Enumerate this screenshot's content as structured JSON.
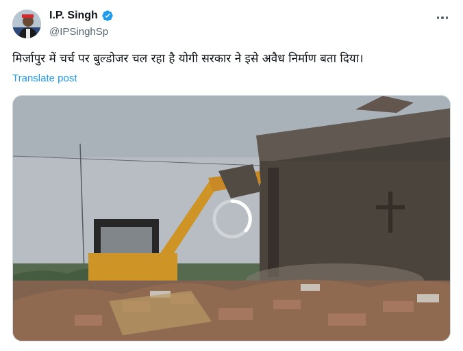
{
  "author": {
    "display_name": "I.P. Singh",
    "handle": "@IPSinghSp",
    "verified": true,
    "verified_color": "#1d9bf0"
  },
  "tweet": {
    "text": "मिर्जापुर में चर्च पर बुल्डोजर चल रहा है योगी सरकार ने इसे अवैध निर्माण बता दिया।",
    "translate_label": "Translate post"
  },
  "media": {
    "type": "video",
    "state": "loading"
  },
  "icons": {
    "more": "more-horizontal-icon",
    "verified": "verified-badge-icon",
    "spinner": "loading-spinner-icon"
  },
  "colors": {
    "link": "#1d9bf0",
    "secondary_text": "#536471",
    "primary_text": "#0f1419"
  }
}
